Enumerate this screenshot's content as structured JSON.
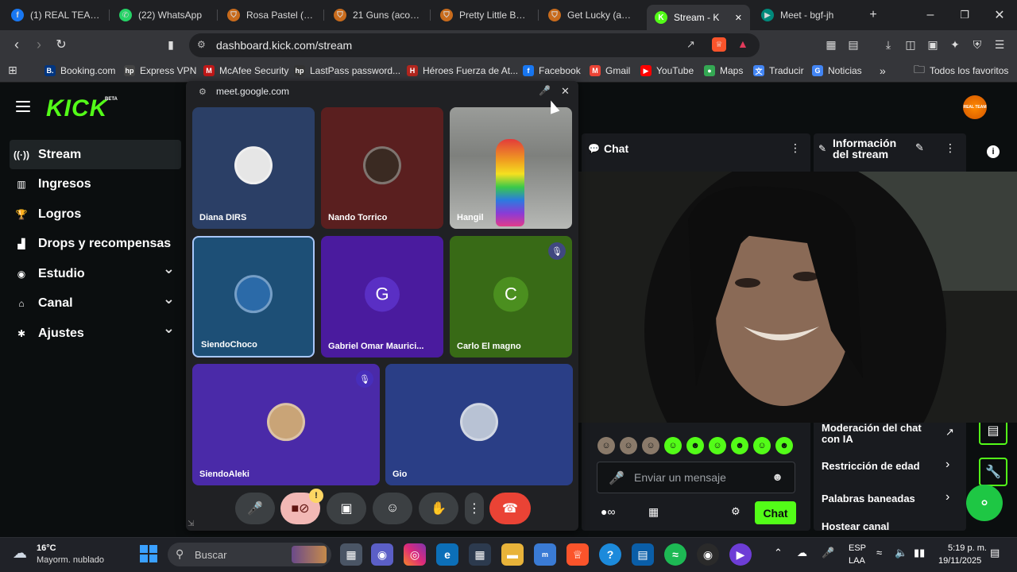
{
  "tabs": [
    {
      "label": "(1) REAL TEAM PR",
      "icon": "facebook-icon",
      "color": "#1877f2",
      "glyph": "f"
    },
    {
      "label": "(22) WhatsApp",
      "icon": "whatsapp-icon",
      "color": "#25d366",
      "glyph": "✆"
    },
    {
      "label": "Rosa Pastel (acord",
      "icon": "shield-icon",
      "color": "#c86b1c",
      "glyph": "⛉"
    },
    {
      "label": "21 Guns (acordes",
      "icon": "shield-icon",
      "color": "#c86b1c",
      "glyph": "⛉"
    },
    {
      "label": "Pretty Little Baby",
      "icon": "shield-icon",
      "color": "#c86b1c",
      "glyph": "⛉"
    },
    {
      "label": "Get Lucky (acorde",
      "icon": "shield-icon",
      "color": "#c86b1c",
      "glyph": "⛉"
    },
    {
      "label": "Stream - K",
      "icon": "kick-icon",
      "color": "#53fc18",
      "glyph": "K",
      "active": true
    },
    {
      "label": "Meet - bgf-jh",
      "icon": "meet-icon",
      "color": "#00897b",
      "glyph": "▶"
    }
  ],
  "new_tab_glyph": "+",
  "window_controls": {
    "minimize": "–",
    "maximize": "❐",
    "close": "✕"
  },
  "omnibox": {
    "url": "dashboard.kick.com/stream"
  },
  "bookmarks": [
    {
      "label": "Booking.com",
      "color": "#003580",
      "glyph": "B."
    },
    {
      "label": "Express VPN",
      "color": "#444",
      "glyph": "hp"
    },
    {
      "label": "McAfee Security",
      "color": "#c01818",
      "glyph": "M"
    },
    {
      "label": "LastPass password...",
      "color": "#333",
      "glyph": "hp"
    },
    {
      "label": "Héroes Fuerza de At...",
      "color": "#b3261e",
      "glyph": "H"
    },
    {
      "label": "Facebook",
      "color": "#1877f2",
      "glyph": "f"
    },
    {
      "label": "Gmail",
      "color": "#ea4335",
      "glyph": "M"
    },
    {
      "label": "YouTube",
      "color": "#ff0000",
      "glyph": "▶"
    },
    {
      "label": "Maps",
      "color": "#34a853",
      "glyph": "●"
    },
    {
      "label": "Traducir",
      "color": "#4285f4",
      "glyph": "文"
    },
    {
      "label": "Noticias",
      "color": "#4285f4",
      "glyph": "G"
    }
  ],
  "bookmarks_more": "»",
  "all_bookmarks": "Todos los favoritos",
  "kick": {
    "logo": "KICK",
    "beta": "BETA",
    "nav": [
      {
        "label": "Stream",
        "icon": "broadcast-icon",
        "glyph": "((·))",
        "active": true
      },
      {
        "label": "Ingresos",
        "icon": "chart-icon",
        "glyph": "▥"
      },
      {
        "label": "Logros",
        "icon": "trophy-icon",
        "glyph": "🏆"
      },
      {
        "label": "Drops y recompensas",
        "icon": "gift-icon",
        "glyph": "▟"
      },
      {
        "label": "Estudio",
        "icon": "studio-icon",
        "glyph": "◉",
        "expand": true
      },
      {
        "label": "Canal",
        "icon": "channel-icon",
        "glyph": "⌂",
        "expand": true
      },
      {
        "label": "Ajustes",
        "icon": "gear-icon",
        "glyph": "✱",
        "expand": true
      }
    ],
    "avatar_text": "REAL TEAM",
    "chat": {
      "title": "Chat",
      "input_placeholder": "Enviar un mensaje",
      "send_label": "Chat"
    },
    "info": {
      "title": "Información del stream",
      "rows": [
        "Moderación del chat con IA",
        "Restricción de edad",
        "Palabras baneadas",
        "Hostear canal"
      ]
    }
  },
  "meet": {
    "url": "meet.google.com",
    "participants": [
      {
        "name": "Diana DIRS",
        "initial": "",
        "bg": "#2b3f66"
      },
      {
        "name": "Nando Torrico",
        "initial": "",
        "bg": "#5a1f1f"
      },
      {
        "name": "Hangil",
        "initial": "",
        "bg": "#8d8f8c"
      },
      {
        "name": "SiendoChoco",
        "initial": "",
        "bg": "#1d4f76"
      },
      {
        "name": "Gabriel Omar Maurici...",
        "initial": "G",
        "bg": "#4a1b9e"
      },
      {
        "name": "Carlo El magno",
        "initial": "C",
        "bg": "#386a16"
      },
      {
        "name": "SiendoAleki",
        "initial": "",
        "bg": "#4a2aa8"
      },
      {
        "name": "Gio",
        "initial": "",
        "bg": "#2a3e86"
      }
    ],
    "controls": {
      "warning": "!",
      "hangup": "☎"
    }
  },
  "taskbar": {
    "weather_temp": "16°C",
    "weather_desc": "Mayorm. nublado",
    "search_placeholder": "Buscar",
    "lang_top": "ESP",
    "lang_bottom": "LAA",
    "time": "5:19 p. m.",
    "date": "19/11/2025"
  }
}
